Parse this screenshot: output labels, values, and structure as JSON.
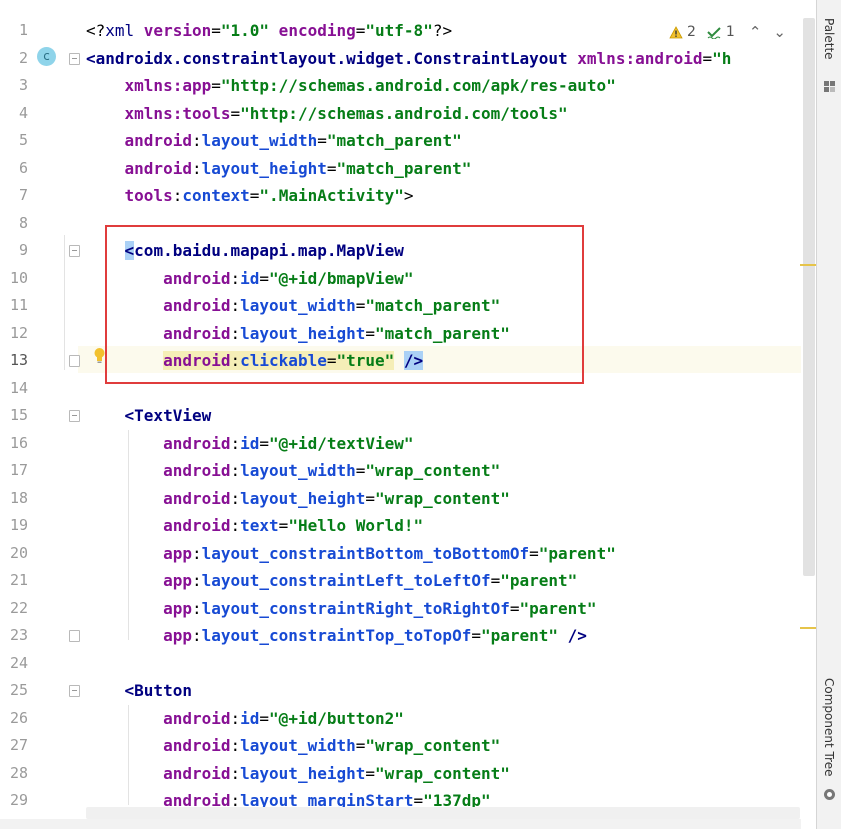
{
  "editor": {
    "line_numbers": [
      "1",
      "2",
      "3",
      "4",
      "5",
      "6",
      "7",
      "8",
      "9",
      "10",
      "11",
      "12",
      "13",
      "14",
      "15",
      "16",
      "17",
      "18",
      "19",
      "20",
      "21",
      "22",
      "23",
      "24",
      "25",
      "26",
      "27",
      "28",
      "29"
    ],
    "lines": [
      [
        {
          "c": "punc",
          "t": "<?"
        },
        {
          "c": "tagn",
          "t": "xml "
        },
        {
          "c": "ns",
          "t": "version"
        },
        {
          "c": "punc",
          "t": "="
        },
        {
          "c": "val",
          "t": "\"1.0\""
        },
        {
          "c": "ns",
          "t": " encoding"
        },
        {
          "c": "punc",
          "t": "="
        },
        {
          "c": "val",
          "t": "\"utf-8\""
        },
        {
          "c": "punc",
          "t": "?>"
        }
      ],
      [
        {
          "c": "tag",
          "t": "<androidx.constraintlayout.widget.ConstraintLayout "
        },
        {
          "c": "ns",
          "t": "xmlns:android"
        },
        {
          "c": "punc",
          "t": "="
        },
        {
          "c": "val",
          "t": "\"h"
        }
      ],
      [
        {
          "c": "punc",
          "t": "    "
        },
        {
          "c": "ns",
          "t": "xmlns:app"
        },
        {
          "c": "punc",
          "t": "="
        },
        {
          "c": "val",
          "t": "\"http://schemas.android.com/apk/res-auto\""
        }
      ],
      [
        {
          "c": "punc",
          "t": "    "
        },
        {
          "c": "ns",
          "t": "xmlns:tools"
        },
        {
          "c": "punc",
          "t": "="
        },
        {
          "c": "val",
          "t": "\"http://schemas.android.com/tools\""
        }
      ],
      [
        {
          "c": "punc",
          "t": "    "
        },
        {
          "c": "ns",
          "t": "android"
        },
        {
          "c": "punc",
          "t": ":"
        },
        {
          "c": "at",
          "t": "layout_width"
        },
        {
          "c": "punc",
          "t": "="
        },
        {
          "c": "val",
          "t": "\"match_parent\""
        }
      ],
      [
        {
          "c": "punc",
          "t": "    "
        },
        {
          "c": "ns",
          "t": "android"
        },
        {
          "c": "punc",
          "t": ":"
        },
        {
          "c": "at",
          "t": "layout_height"
        },
        {
          "c": "punc",
          "t": "="
        },
        {
          "c": "val",
          "t": "\"match_parent\""
        }
      ],
      [
        {
          "c": "punc",
          "t": "    "
        },
        {
          "c": "ns",
          "t": "tools"
        },
        {
          "c": "punc",
          "t": ":"
        },
        {
          "c": "at",
          "t": "context"
        },
        {
          "c": "punc",
          "t": "="
        },
        {
          "c": "val",
          "t": "\".MainActivity\""
        },
        {
          "c": "punc",
          "t": ">"
        }
      ],
      [],
      [
        {
          "c": "punc",
          "t": "    "
        },
        {
          "c": "tag hl-bracket",
          "t": "<"
        },
        {
          "c": "tag",
          "t": "com.baidu.mapapi.map.MapView"
        }
      ],
      [
        {
          "c": "punc",
          "t": "        "
        },
        {
          "c": "ns",
          "t": "android"
        },
        {
          "c": "punc",
          "t": ":"
        },
        {
          "c": "at",
          "t": "id"
        },
        {
          "c": "punc",
          "t": "="
        },
        {
          "c": "val",
          "t": "\"@+id/bmapView\""
        }
      ],
      [
        {
          "c": "punc",
          "t": "        "
        },
        {
          "c": "ns",
          "t": "android"
        },
        {
          "c": "punc",
          "t": ":"
        },
        {
          "c": "at",
          "t": "layout_width"
        },
        {
          "c": "punc",
          "t": "="
        },
        {
          "c": "val",
          "t": "\"match_parent\""
        }
      ],
      [
        {
          "c": "punc",
          "t": "        "
        },
        {
          "c": "ns",
          "t": "android"
        },
        {
          "c": "punc",
          "t": ":"
        },
        {
          "c": "at",
          "t": "layout_height"
        },
        {
          "c": "punc",
          "t": "="
        },
        {
          "c": "val",
          "t": "\"match_parent\""
        }
      ],
      [
        {
          "c": "punc",
          "t": "        "
        },
        {
          "c": "ns hl-attr",
          "t": "android"
        },
        {
          "c": "punc hl-attr",
          "t": ":"
        },
        {
          "c": "at hl-attr",
          "t": "clickable"
        },
        {
          "c": "punc hl-attr",
          "t": "="
        },
        {
          "c": "val hl-attr",
          "t": "\"true\""
        },
        {
          "c": "punc",
          "t": " "
        },
        {
          "c": "tag hl-bracket",
          "t": "/>"
        }
      ],
      [],
      [
        {
          "c": "punc",
          "t": "    "
        },
        {
          "c": "tag",
          "t": "<TextView"
        }
      ],
      [
        {
          "c": "punc",
          "t": "        "
        },
        {
          "c": "ns",
          "t": "android"
        },
        {
          "c": "punc",
          "t": ":"
        },
        {
          "c": "at",
          "t": "id"
        },
        {
          "c": "punc",
          "t": "="
        },
        {
          "c": "val",
          "t": "\"@+id/textView\""
        }
      ],
      [
        {
          "c": "punc",
          "t": "        "
        },
        {
          "c": "ns",
          "t": "android"
        },
        {
          "c": "punc",
          "t": ":"
        },
        {
          "c": "at",
          "t": "layout_width"
        },
        {
          "c": "punc",
          "t": "="
        },
        {
          "c": "val",
          "t": "\"wrap_content\""
        }
      ],
      [
        {
          "c": "punc",
          "t": "        "
        },
        {
          "c": "ns",
          "t": "android"
        },
        {
          "c": "punc",
          "t": ":"
        },
        {
          "c": "at",
          "t": "layout_height"
        },
        {
          "c": "punc",
          "t": "="
        },
        {
          "c": "val",
          "t": "\"wrap_content\""
        }
      ],
      [
        {
          "c": "punc",
          "t": "        "
        },
        {
          "c": "ns",
          "t": "android"
        },
        {
          "c": "punc",
          "t": ":"
        },
        {
          "c": "at",
          "t": "text"
        },
        {
          "c": "punc",
          "t": "="
        },
        {
          "c": "val",
          "t": "\"Hello World!\""
        }
      ],
      [
        {
          "c": "punc",
          "t": "        "
        },
        {
          "c": "ns",
          "t": "app"
        },
        {
          "c": "punc",
          "t": ":"
        },
        {
          "c": "at",
          "t": "layout_constraintBottom_toBottomOf"
        },
        {
          "c": "punc",
          "t": "="
        },
        {
          "c": "val",
          "t": "\"parent\""
        }
      ],
      [
        {
          "c": "punc",
          "t": "        "
        },
        {
          "c": "ns",
          "t": "app"
        },
        {
          "c": "punc",
          "t": ":"
        },
        {
          "c": "at",
          "t": "layout_constraintLeft_toLeftOf"
        },
        {
          "c": "punc",
          "t": "="
        },
        {
          "c": "val",
          "t": "\"parent\""
        }
      ],
      [
        {
          "c": "punc",
          "t": "        "
        },
        {
          "c": "ns",
          "t": "app"
        },
        {
          "c": "punc",
          "t": ":"
        },
        {
          "c": "at",
          "t": "layout_constraintRight_toRightOf"
        },
        {
          "c": "punc",
          "t": "="
        },
        {
          "c": "val",
          "t": "\"parent\""
        }
      ],
      [
        {
          "c": "punc",
          "t": "        "
        },
        {
          "c": "ns",
          "t": "app"
        },
        {
          "c": "punc",
          "t": ":"
        },
        {
          "c": "at",
          "t": "layout_constraintTop_toTopOf"
        },
        {
          "c": "punc",
          "t": "="
        },
        {
          "c": "val",
          "t": "\"parent\""
        },
        {
          "c": "punc",
          "t": " "
        },
        {
          "c": "tag",
          "t": "/>"
        }
      ],
      [],
      [
        {
          "c": "punc",
          "t": "    "
        },
        {
          "c": "tag",
          "t": "<Button"
        }
      ],
      [
        {
          "c": "punc",
          "t": "        "
        },
        {
          "c": "ns",
          "t": "android"
        },
        {
          "c": "punc",
          "t": ":"
        },
        {
          "c": "at",
          "t": "id"
        },
        {
          "c": "punc",
          "t": "="
        },
        {
          "c": "val",
          "t": "\"@+id/button2\""
        }
      ],
      [
        {
          "c": "punc",
          "t": "        "
        },
        {
          "c": "ns",
          "t": "android"
        },
        {
          "c": "punc",
          "t": ":"
        },
        {
          "c": "at",
          "t": "layout_width"
        },
        {
          "c": "punc",
          "t": "="
        },
        {
          "c": "val",
          "t": "\"wrap_content\""
        }
      ],
      [
        {
          "c": "punc",
          "t": "        "
        },
        {
          "c": "ns",
          "t": "android"
        },
        {
          "c": "punc",
          "t": ":"
        },
        {
          "c": "at",
          "t": "layout_height"
        },
        {
          "c": "punc",
          "t": "="
        },
        {
          "c": "val",
          "t": "\"wrap_content\""
        }
      ],
      [
        {
          "c": "punc",
          "t": "        "
        },
        {
          "c": "ns",
          "t": "android"
        },
        {
          "c": "punc",
          "t": ":"
        },
        {
          "c": "at",
          "t": "layout_marginStart"
        },
        {
          "c": "punc",
          "t": "="
        },
        {
          "c": "val",
          "t": "\"137dp\""
        }
      ]
    ]
  },
  "inspections": {
    "warnings_count": "2",
    "typos_count": "1",
    "warning_icon": "warning-triangle-icon",
    "typo_icon": "checkmark-typo-icon"
  },
  "side_panels": {
    "palette_label": "Palette",
    "component_tree_label": "Component Tree"
  },
  "colors": {
    "tag": "#000080",
    "namespace": "#871094",
    "attribute": "#174ad4",
    "value": "#067d17",
    "annotation_box": "#e03c3c",
    "current_line": "#fcfaed"
  }
}
